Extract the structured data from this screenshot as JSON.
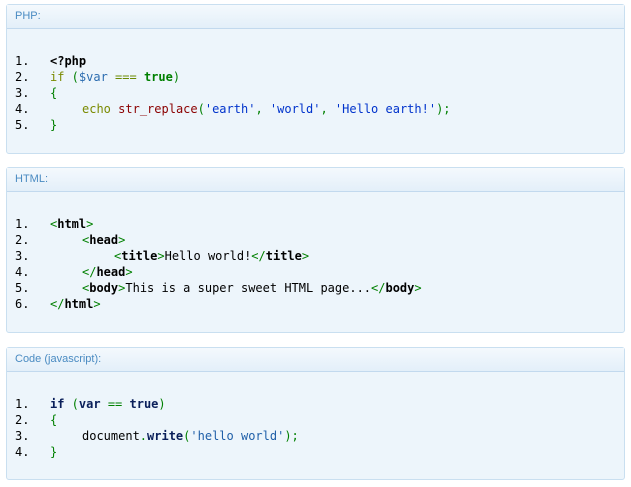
{
  "blocks": [
    {
      "title": "PHP:",
      "lines": [
        {
          "num": "1.",
          "indent": 0,
          "parts": [
            {
              "t": "<?php",
              "c": "k-php"
            }
          ]
        },
        {
          "num": "2.",
          "indent": 0,
          "parts": [
            {
              "t": "if",
              "c": "k-kw"
            },
            {
              "t": " (",
              "c": "k-punc"
            },
            {
              "t": "$var",
              "c": "k-var"
            },
            {
              "t": " === ",
              "c": "k-op"
            },
            {
              "t": "true",
              "c": "k-bool"
            },
            {
              "t": ")",
              "c": "k-punc"
            }
          ]
        },
        {
          "num": "3.",
          "indent": 0,
          "parts": [
            {
              "t": "{",
              "c": "k-brace"
            }
          ]
        },
        {
          "num": "4.",
          "indent": 1,
          "parts": [
            {
              "t": "echo",
              "c": "k-kw"
            },
            {
              "t": " ",
              "c": "k-punc"
            },
            {
              "t": "str_replace",
              "c": "k-fn"
            },
            {
              "t": "(",
              "c": "k-punc"
            },
            {
              "t": "'earth'",
              "c": "k-str"
            },
            {
              "t": ", ",
              "c": "k-punc"
            },
            {
              "t": "'world'",
              "c": "k-str"
            },
            {
              "t": ", ",
              "c": "k-punc"
            },
            {
              "t": "'Hello earth!'",
              "c": "k-str"
            },
            {
              "t": ");",
              "c": "k-punc"
            }
          ]
        },
        {
          "num": "5.",
          "indent": 0,
          "parts": [
            {
              "t": "}",
              "c": "k-brace"
            }
          ]
        }
      ]
    },
    {
      "title": "HTML:",
      "lines": [
        {
          "num": "1.",
          "indent": 0,
          "parts": [
            {
              "t": "<",
              "c": "t-punc"
            },
            {
              "t": "html",
              "c": "t-tag"
            },
            {
              "t": ">",
              "c": "t-punc"
            }
          ]
        },
        {
          "num": "2.",
          "indent": 1,
          "parts": [
            {
              "t": "<",
              "c": "t-punc"
            },
            {
              "t": "head",
              "c": "t-tag"
            },
            {
              "t": ">",
              "c": "t-punc"
            }
          ]
        },
        {
          "num": "3.",
          "indent": 2,
          "parts": [
            {
              "t": "<",
              "c": "t-punc"
            },
            {
              "t": "title",
              "c": "t-tag"
            },
            {
              "t": ">",
              "c": "t-punc"
            },
            {
              "t": "Hello world!",
              "c": "t-text"
            },
            {
              "t": "</",
              "c": "t-punc"
            },
            {
              "t": "title",
              "c": "t-tag"
            },
            {
              "t": ">",
              "c": "t-punc"
            }
          ]
        },
        {
          "num": "4.",
          "indent": 1,
          "parts": [
            {
              "t": "</",
              "c": "t-punc"
            },
            {
              "t": "head",
              "c": "t-tag"
            },
            {
              "t": ">",
              "c": "t-punc"
            }
          ]
        },
        {
          "num": "5.",
          "indent": 1,
          "parts": [
            {
              "t": "<",
              "c": "t-punc"
            },
            {
              "t": "body",
              "c": "t-tag"
            },
            {
              "t": ">",
              "c": "t-punc"
            },
            {
              "t": "This is a super sweet HTML page...",
              "c": "t-text"
            },
            {
              "t": "</",
              "c": "t-punc"
            },
            {
              "t": "body",
              "c": "t-tag"
            },
            {
              "t": ">",
              "c": "t-punc"
            }
          ]
        },
        {
          "num": "6.",
          "indent": 0,
          "parts": [
            {
              "t": "</",
              "c": "t-punc"
            },
            {
              "t": "html",
              "c": "t-tag"
            },
            {
              "t": ">",
              "c": "t-punc"
            }
          ]
        }
      ]
    },
    {
      "title": "Code (javascript):",
      "lines": [
        {
          "num": "1.",
          "indent": 0,
          "parts": [
            {
              "t": "if",
              "c": "j-kw"
            },
            {
              "t": " (",
              "c": "j-punc"
            },
            {
              "t": "var",
              "c": "j-var"
            },
            {
              "t": " == ",
              "c": "j-op"
            },
            {
              "t": "true",
              "c": "j-bool"
            },
            {
              "t": ")",
              "c": "j-punc"
            }
          ]
        },
        {
          "num": "2.",
          "indent": 0,
          "parts": [
            {
              "t": "{",
              "c": "j-punc"
            }
          ]
        },
        {
          "num": "3.",
          "indent": 1,
          "parts": [
            {
              "t": "document",
              "c": "j-plain"
            },
            {
              "t": ".",
              "c": "j-punc"
            },
            {
              "t": "write",
              "c": "j-method"
            },
            {
              "t": "(",
              "c": "j-punc"
            },
            {
              "t": "'hello world'",
              "c": "j-str"
            },
            {
              "t": ");",
              "c": "j-punc"
            }
          ]
        },
        {
          "num": "4.",
          "indent": 0,
          "parts": [
            {
              "t": "}",
              "c": "j-punc"
            }
          ]
        }
      ]
    }
  ]
}
